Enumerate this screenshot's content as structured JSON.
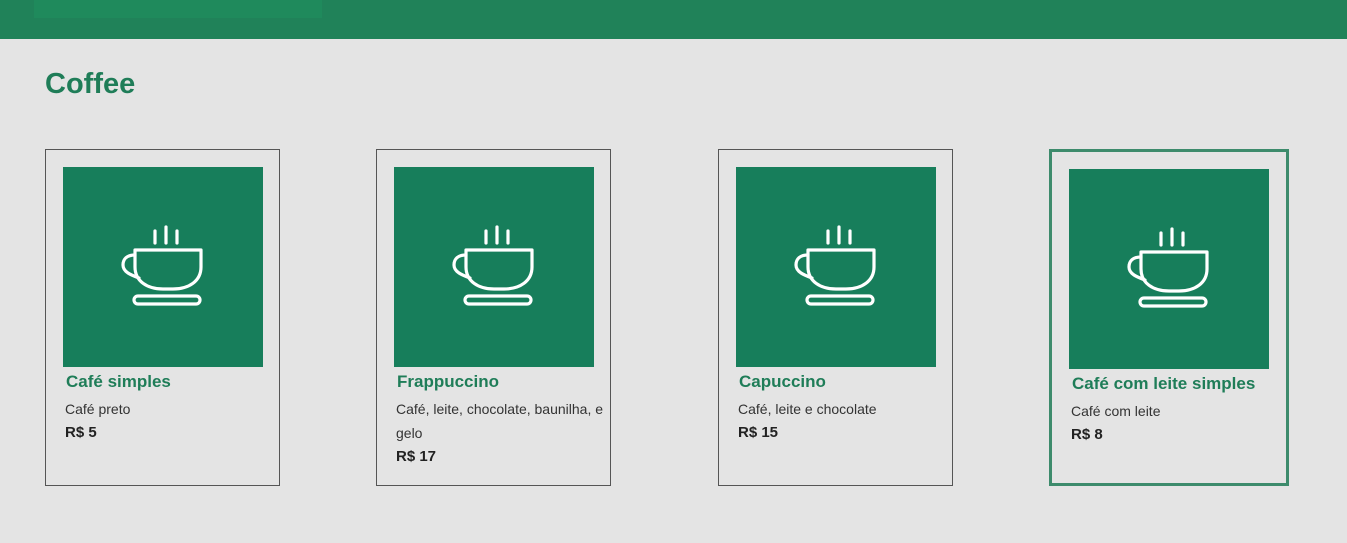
{
  "header": {
    "title": "Coffee"
  },
  "products": [
    {
      "name": "Café simples",
      "description": "Café preto",
      "price": "R$ 5",
      "icon": "coffee-cup-icon"
    },
    {
      "name": "Frappuccino",
      "description": "Café, leite, chocolate, baunilha, e gelo",
      "price": "R$ 17",
      "icon": "coffee-cup-icon"
    },
    {
      "name": "Capuccino",
      "description": "Café, leite e chocolate",
      "price": "R$ 15",
      "icon": "coffee-cup-icon"
    },
    {
      "name": "Café com leite simples",
      "description": "Café com leite",
      "price": "R$ 8",
      "icon": "coffee-cup-icon",
      "selected": true
    }
  ],
  "colors": {
    "brand": "#208259",
    "card_image": "#177e5b",
    "title": "#1f7d58",
    "background": "#e4e4e4"
  }
}
